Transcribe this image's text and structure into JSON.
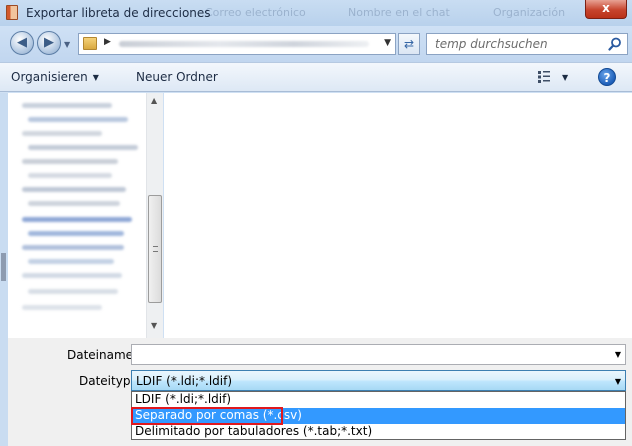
{
  "window": {
    "title": "Exportar libreta de direcciones",
    "close_label": "x",
    "background_tabs": [
      "Correo electrónico",
      "Nombre en el chat",
      "Organización"
    ]
  },
  "address_bar": {
    "back_icon": "arrow-left-icon",
    "forward_icon": "arrow-right-icon",
    "path_folder_icon": "folder-icon",
    "refresh_icon": "refresh-icon",
    "search_placeholder": "temp durchsuchen",
    "search_icon": "magnifier-icon"
  },
  "command_bar": {
    "organize_label": "Organisieren",
    "new_folder_label": "Neuer Ordner",
    "view_icon": "view-grid-icon",
    "help_label": "?"
  },
  "form": {
    "filename_label": "Dateiname:",
    "filename_value": "",
    "filetype_label": "Dateityp:",
    "filetype_value": "LDIF (*.ldi;*.ldif)",
    "filetype_options": [
      "LDIF (*.ldi;*.ldif)",
      "Separado por comas (*.csv)",
      "Delimitado por tabuladores (*.tab;*.txt)"
    ],
    "selected_option_index": 1
  },
  "colors": {
    "selection": "#3399ff",
    "highlight_frame": "#e0181e",
    "close_button": "#c7442d"
  }
}
